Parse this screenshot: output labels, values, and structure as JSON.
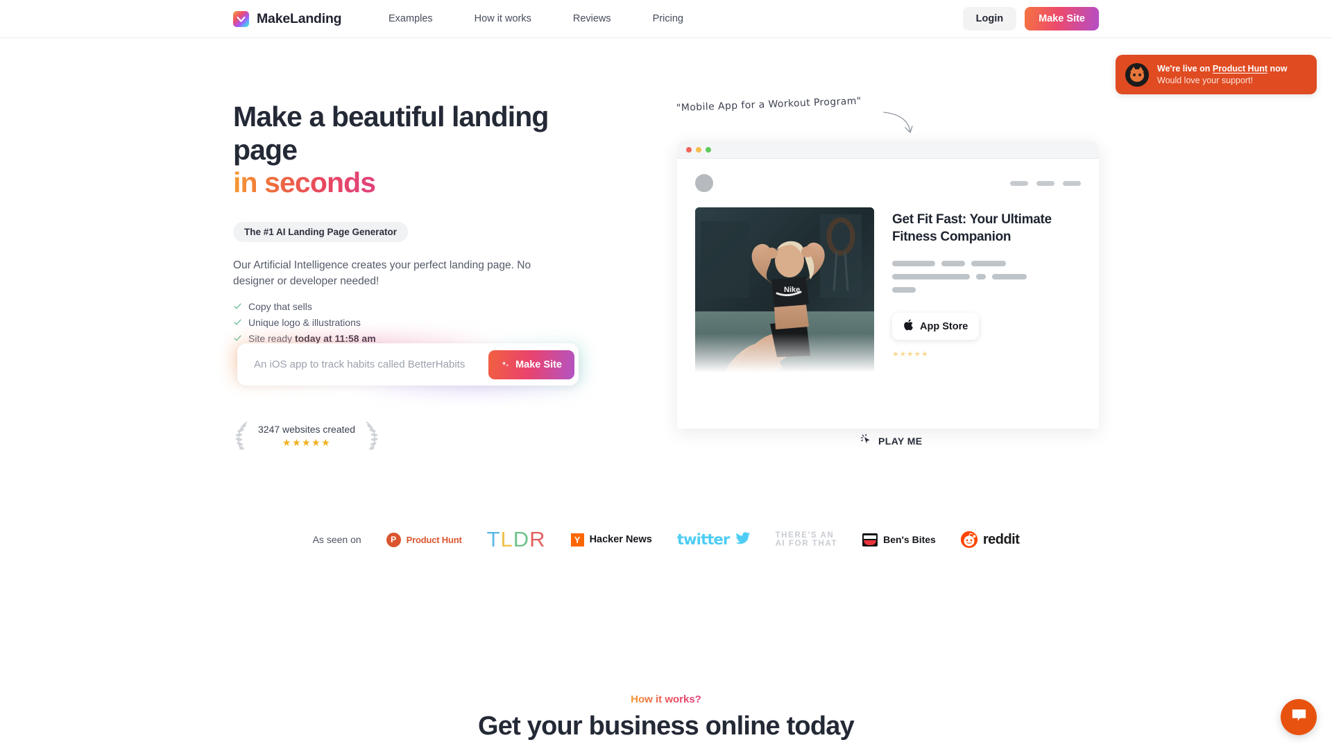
{
  "header": {
    "brand_name": "MakeLanding",
    "nav": [
      {
        "label": "Examples"
      },
      {
        "label": "How it works"
      },
      {
        "label": "Reviews"
      },
      {
        "label": "Pricing"
      }
    ],
    "login_label": "Login",
    "make_site_label": "Make Site"
  },
  "product_hunt_banner": {
    "line1_prefix": "We're live on ",
    "line1_link": "Product Hunt",
    "line1_suffix": " now",
    "line2": "Would love your support!",
    "bg_color": "#e04b22"
  },
  "hero": {
    "heading_line1": "Make a beautiful landing page",
    "heading_line2": "in seconds",
    "badge": "The #1 AI Landing Page Generator",
    "description": "Our Artificial Intelligence creates your perfect landing page. No designer or developer needed!",
    "bullets": [
      {
        "text": "Copy that sells",
        "bold": ""
      },
      {
        "text": "Unique logo & illustrations",
        "bold": ""
      },
      {
        "text": "Site ready ",
        "bold": "today at 11:58 am"
      }
    ],
    "input_placeholder": "An iOS app to track habits called BetterHabits",
    "input_value": "",
    "cta_label": "Make Site",
    "social_proof_count": "3247 websites created",
    "social_proof_stars": "★★★★★",
    "gradient_start": "#f59b35",
    "gradient_end": "#e0417b"
  },
  "preview": {
    "annotation": "\"Mobile App for a Workout Program\"",
    "mock_title": "Get Fit Fast: Your Ultimate Fitness Companion",
    "app_store_label": "App Store",
    "mock_stars": "★★★★★",
    "play_me_label": "PLAY ME"
  },
  "as_seen_on": {
    "label": "As seen on",
    "logos": [
      {
        "name": "Product Hunt",
        "mark": "P"
      },
      {
        "name": "TLDR",
        "letters": [
          "T",
          "L",
          "D",
          "R"
        ]
      },
      {
        "name": "Hacker News",
        "mark": "Y"
      },
      {
        "name": "twitter"
      },
      {
        "name": "THERE'S AN AI FOR THAT",
        "line1": "THERE'S AN",
        "line2": "AI FOR THAT"
      },
      {
        "name": "Ben's Bites"
      },
      {
        "name": "reddit"
      }
    ]
  },
  "how_it_works": {
    "eyebrow": "How it works?",
    "title": "Get your business online today"
  },
  "chat": {
    "icon": "chat-bubble-icon",
    "color": "#e8520f"
  }
}
